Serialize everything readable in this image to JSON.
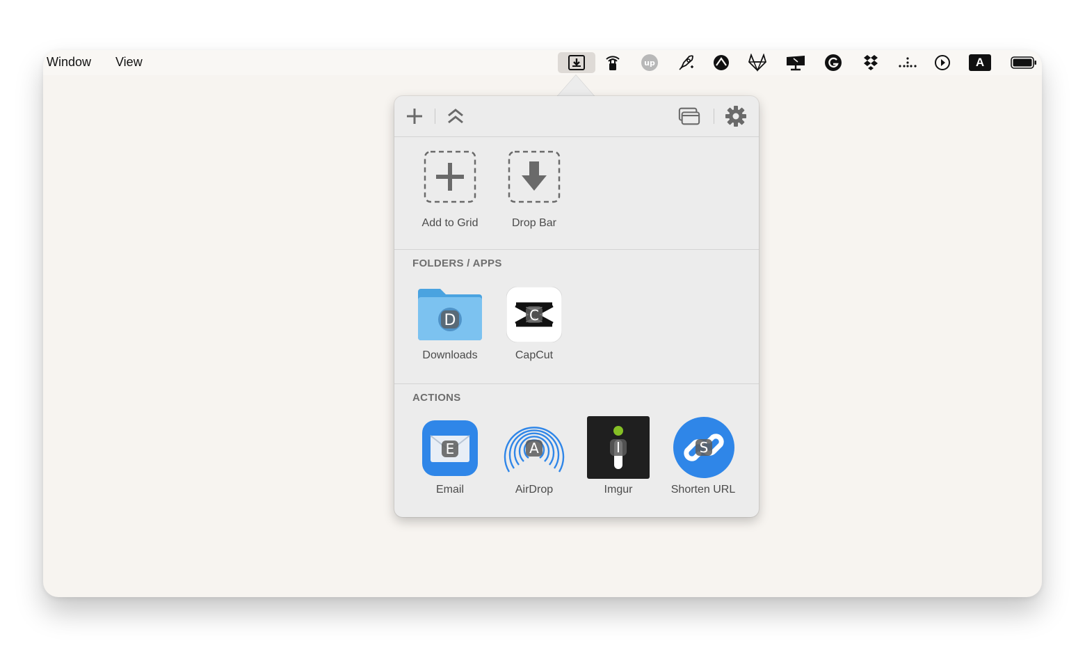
{
  "menubar": {
    "items": [
      "Window",
      "View"
    ],
    "status_icons": [
      "dropzone-icon",
      "wifi-lock-icon",
      "upwork-icon",
      "rocket-icon",
      "astro-icon",
      "gitlab-fox-icon",
      "display-icon",
      "grammarly-icon",
      "dropbox-icon",
      "dots-icon",
      "play-circle-icon",
      "keyboard-input-icon",
      "battery-icon"
    ],
    "keyboard_input_letter": "A"
  },
  "popover": {
    "toolbar": {
      "add_icon": "plus-icon",
      "collapse_icon": "double-chevron-up-icon",
      "window_icon": "window-stack-icon",
      "settings_icon": "gear-icon"
    },
    "top_tiles": [
      {
        "label": "Add to Grid",
        "icon": "dashed-plus-icon"
      },
      {
        "label": "Drop Bar",
        "icon": "dashed-down-arrow-icon"
      }
    ],
    "folders": {
      "header": "FOLDERS / APPS",
      "items": [
        {
          "label": "Downloads",
          "icon": "folder-icon",
          "badge": "D"
        },
        {
          "label": "CapCut",
          "icon": "capcut-icon",
          "badge": "C"
        }
      ]
    },
    "actions": {
      "header": "ACTIONS",
      "items": [
        {
          "label": "Email",
          "icon": "mail-icon",
          "badge": "E"
        },
        {
          "label": "AirDrop",
          "icon": "airdrop-icon",
          "badge": "A"
        },
        {
          "label": "Imgur",
          "icon": "imgur-icon",
          "badge": "I"
        },
        {
          "label": "Shorten URL",
          "icon": "link-icon",
          "badge": "S"
        }
      ]
    }
  }
}
